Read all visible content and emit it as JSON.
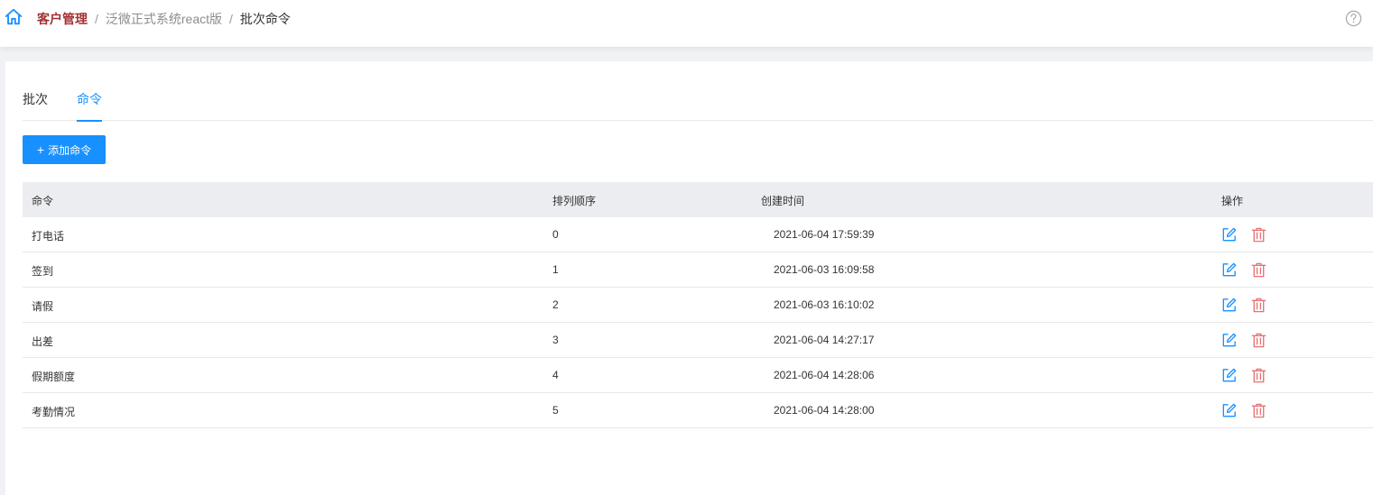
{
  "breadcrumb": {
    "items": [
      "客户管理",
      "泛微正式系统react版",
      "批次命令"
    ],
    "separator": "/"
  },
  "icons": {
    "home": "home-icon",
    "help": "help-circle-icon",
    "edit": "edit-icon",
    "delete": "trash-icon"
  },
  "colors": {
    "primary": "#1890ff",
    "breadcrumb_active": "#a23131",
    "danger": "#e57373",
    "header_bg": "#ebedf0"
  },
  "tabs": [
    {
      "label": "批次",
      "active": false
    },
    {
      "label": "命令",
      "active": true
    }
  ],
  "toolbar": {
    "add_label": "添加命令",
    "add_prefix": "+"
  },
  "table": {
    "columns": [
      "命令",
      "排列顺序",
      "创建时间",
      "操作"
    ],
    "rows": [
      {
        "command": "打电话",
        "order": "0",
        "created": "2021-06-04 17:59:39"
      },
      {
        "command": "签到",
        "order": "1",
        "created": "2021-06-03 16:09:58"
      },
      {
        "command": "请假",
        "order": "2",
        "created": "2021-06-03 16:10:02"
      },
      {
        "command": "出差",
        "order": "3",
        "created": "2021-06-04 14:27:17"
      },
      {
        "command": "假期额度",
        "order": "4",
        "created": "2021-06-04 14:28:06"
      },
      {
        "command": "考勤情况",
        "order": "5",
        "created": "2021-06-04 14:28:00"
      }
    ]
  }
}
